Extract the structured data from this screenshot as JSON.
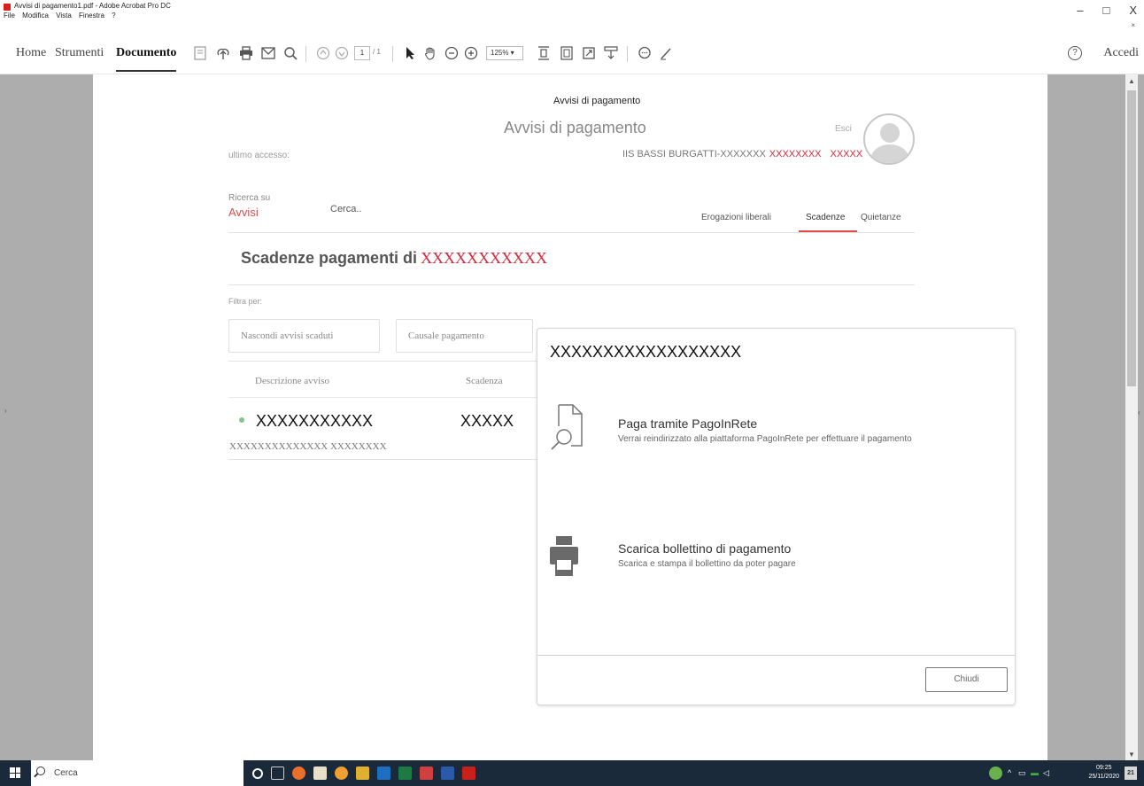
{
  "window": {
    "title": "Avvisi di pagamento1.pdf - Adobe Acrobat Pro DC",
    "menu": [
      "File",
      "Modifica",
      "Vista",
      "Finestra",
      "?"
    ],
    "controls": [
      "–",
      "□",
      "X"
    ],
    "small_close": "×"
  },
  "toolbar": {
    "tabs": [
      "Home",
      "Strumenti",
      "Documento"
    ],
    "active_tab": "Documento",
    "page_current": "1",
    "page_total": "/ 1",
    "zoom": "125%  ▾",
    "sign_in": "Accedi",
    "help_glyph": "?"
  },
  "page": {
    "small_header": "Avvisi di pagamento",
    "title": "Avvisi di pagamento",
    "esci": "Esci",
    "ultimo_accesso": "ultimo accesso:",
    "school_name": "IIS BASSI BURGATTI-XXXXXXX",
    "school_red1": "XXXXXXXX",
    "school_red2": "XXXXX",
    "ricerca_label": "Ricerca su",
    "avvisi_link": "Avvisi",
    "cerca": "Cerca..",
    "nav_tabs": [
      "Erogazioni liberali",
      "Scadenze",
      "Quietanze"
    ],
    "section_title": "Scadenze pagamenti di",
    "section_name_red": "XXXXXXXXXXX",
    "filtra_per": "Filtra per:",
    "filters": [
      "Nascondi avvisi scaduti",
      "Causale pagamento"
    ],
    "columns": [
      "Descrizione avviso",
      "Scadenza"
    ],
    "rows": [
      {
        "description": "XXXXXXXXXXX",
        "due": "XXXXX",
        "sub": "XXXXXXXXXXXXXX XXXXXXXX",
        "status_color": "#8ac28a"
      }
    ]
  },
  "modal": {
    "title": "XXXXXXXXXXXXXXXXXX",
    "options": [
      {
        "title": "Paga tramite PagoInRete",
        "desc": "Verrai reindirizzato alla piattaforma PagoInRete per effettuare il pagamento",
        "icon": "document-search-icon"
      },
      {
        "title": "Scarica bollettino di pagamento",
        "desc": "Scarica e stampa il bollettino da poter pagare",
        "icon": "printer-icon"
      }
    ],
    "close_label": "Chiudi"
  },
  "taskbar": {
    "search_text": "Cerca",
    "time": "09:25",
    "date": "25/11/2020",
    "notifications": "21"
  },
  "colors": {
    "accent_red": "#d9283a",
    "link_red": "#e04b4b",
    "taskbar": "#1b2a3a",
    "pdf_background": "#adadad"
  }
}
